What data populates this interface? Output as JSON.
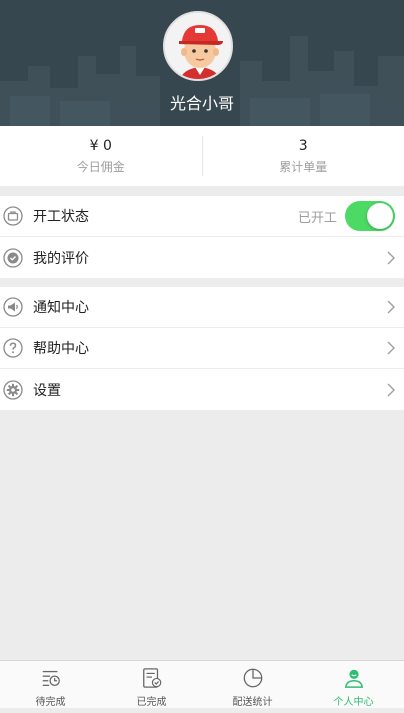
{
  "header": {
    "username": "光合小哥",
    "background_color": "#37474f"
  },
  "stats": {
    "commission_value": "¥ 0",
    "commission_label": "今日佣金",
    "orders_value": "3",
    "orders_label": "累计单量"
  },
  "menu": {
    "work_status": {
      "label": "开工状态",
      "status_text": "已开工",
      "switch_on": true,
      "icon": "briefcase-icon"
    },
    "my_rating": {
      "label": "我的评价",
      "icon": "check-badge-icon"
    },
    "notifications": {
      "label": "通知中心",
      "icon": "megaphone-icon"
    },
    "help": {
      "label": "帮助中心",
      "icon": "question-icon"
    },
    "settings": {
      "label": "设置",
      "icon": "gear-icon"
    }
  },
  "tabbar": {
    "tabs": [
      {
        "label": "待完成",
        "icon": "pending-list-icon",
        "active": false
      },
      {
        "label": "已完成",
        "icon": "completed-list-icon",
        "active": false
      },
      {
        "label": "配送统计",
        "icon": "pie-chart-icon",
        "active": false
      },
      {
        "label": "个人中心",
        "icon": "person-icon",
        "active": true
      }
    ]
  },
  "colors": {
    "accent_green": "#2fbf71",
    "switch_green": "#4cd964"
  }
}
